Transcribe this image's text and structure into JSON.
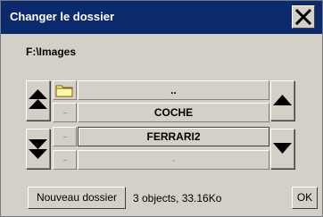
{
  "window": {
    "title": "Changer le dossier",
    "close_icon": "close-icon"
  },
  "current_path": "F:\\Images",
  "list": {
    "rows": [
      {
        "label": "..",
        "icon": "folder-icon"
      },
      {
        "label": "COCHE",
        "icon": ""
      },
      {
        "label": "FERRARI2",
        "icon": "",
        "selected": true
      },
      {
        "label": "-",
        "icon": ""
      }
    ]
  },
  "nav": {
    "page_up_icon": "double-up-arrow-icon",
    "page_down_icon": "double-down-arrow-icon",
    "scroll_up_icon": "up-arrow-icon",
    "scroll_down_icon": "down-arrow-icon"
  },
  "footer": {
    "new_folder_label": "Nouveau dossier",
    "status": "3 objects, 33.16Ko",
    "ok_label": "OK"
  },
  "colors": {
    "titlebar": "#0b2a6e",
    "dialog_bg": "#d4d0c8"
  }
}
